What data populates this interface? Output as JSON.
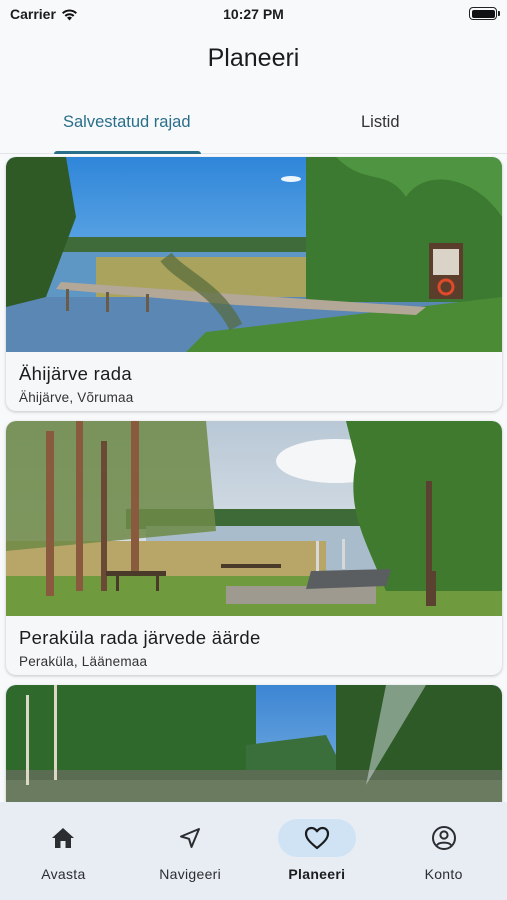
{
  "status": {
    "carrier": "Carrier",
    "time": "10:27 PM"
  },
  "header": {
    "title": "Planeeri"
  },
  "tabs": [
    {
      "label": "Salvestatud rajad",
      "active": true
    },
    {
      "label": "Listid",
      "active": false
    }
  ],
  "trails": [
    {
      "title": "Ähijärve rada",
      "location": "Ähijärve, Võrumaa"
    },
    {
      "title": "Peraküla rada järvede äärde",
      "location": "Peraküla, Läänemaa"
    },
    {
      "title": "",
      "location": ""
    }
  ],
  "nav": [
    {
      "label": "Avasta",
      "icon": "home-icon"
    },
    {
      "label": "Navigeeri",
      "icon": "navigation-arrow-icon"
    },
    {
      "label": "Planeeri",
      "icon": "heart-icon",
      "active": true
    },
    {
      "label": "Konto",
      "icon": "account-circle-icon"
    }
  ],
  "colors": {
    "accent": "#2a6f8a",
    "nav_bg": "#e7edf3",
    "nav_active_pill": "#cfe3f5"
  }
}
